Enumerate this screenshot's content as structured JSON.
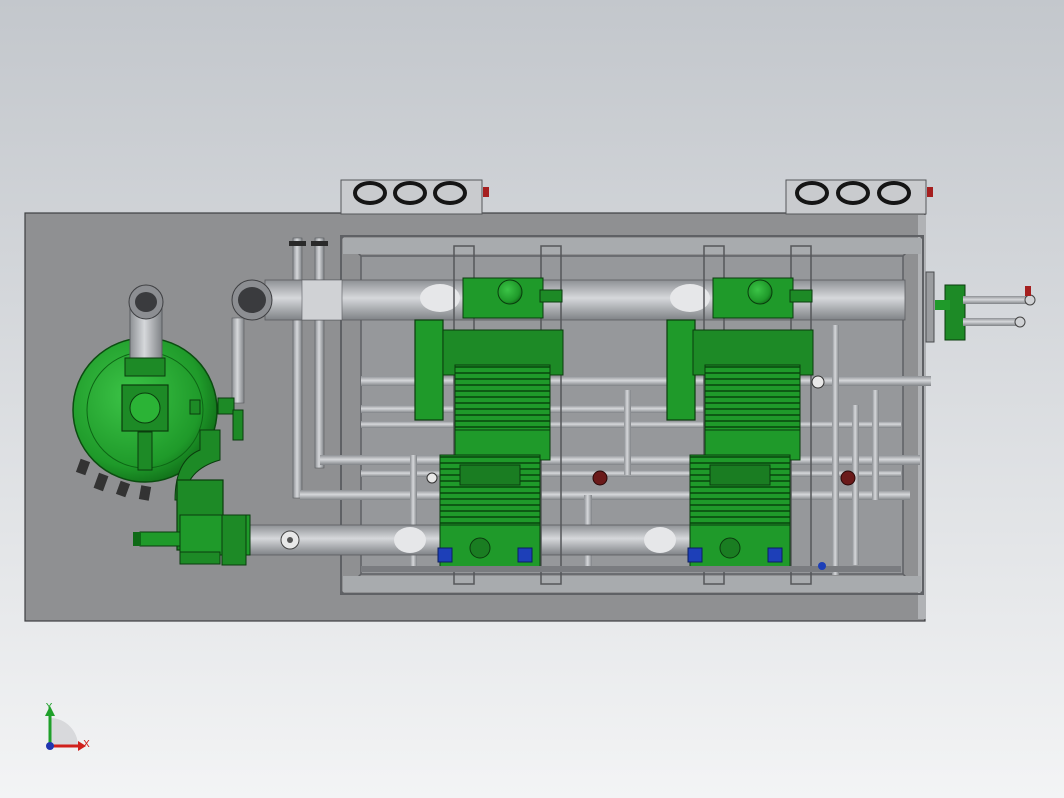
{
  "viewport": {
    "view": "top",
    "background_colors": {
      "top": "#c3c7cc",
      "bottom": "#f3f4f5"
    }
  },
  "model": {
    "colors": {
      "base_plate": "#8f9092",
      "frame": "#6e7074",
      "pipe": "#a6a9ad",
      "pipe_highlight": "#cfd2d5",
      "compressor_green": "#1f9a2a",
      "compressor_dark": "#0b5e12",
      "motor_blue": "#1d3fb8",
      "valve_red": "#a51f1f"
    },
    "compressors": [
      {
        "label": ""
      },
      {
        "label": ""
      }
    ],
    "fan_units": [
      {
        "fans": 3
      },
      {
        "fans": 3
      }
    ]
  },
  "triad": {
    "x_label": "X",
    "y_label": "Y",
    "x_color": "#d0201c",
    "y_color": "#1fa02a",
    "z_color": "#2036b0"
  }
}
